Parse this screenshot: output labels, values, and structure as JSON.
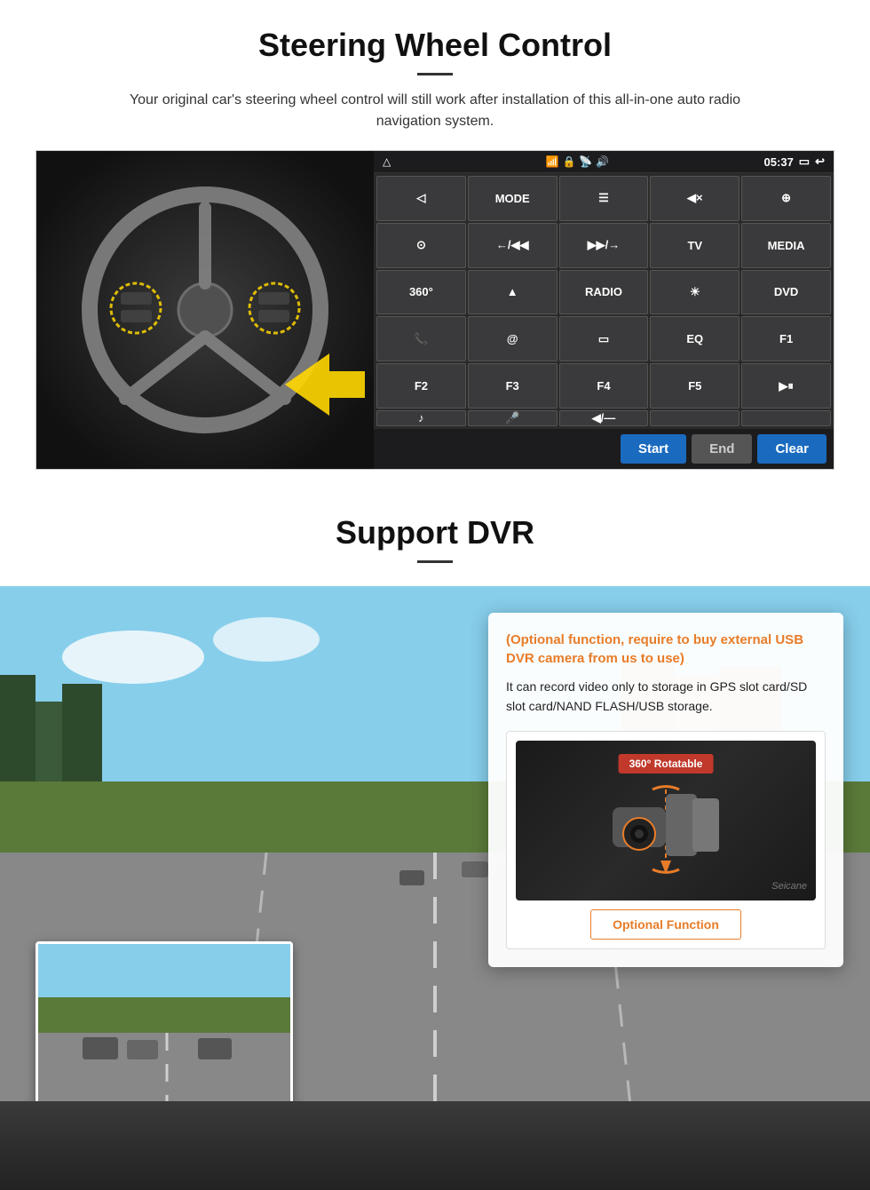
{
  "steering_section": {
    "title": "Steering Wheel Control",
    "description": "Your original car's steering wheel control will still work after installation of this all-in-one auto radio navigation system.",
    "status_bar": {
      "time": "05:37",
      "back_icon": "↩",
      "home_icon": "△",
      "wifi_icon": "wifi",
      "lock_icon": "🔒",
      "signal_icon": "📶",
      "sound_icon": "🔊"
    },
    "grid_buttons": [
      {
        "label": "◁",
        "row": 1,
        "col": 1
      },
      {
        "label": "MODE",
        "row": 1,
        "col": 2
      },
      {
        "label": "☰",
        "row": 1,
        "col": 3
      },
      {
        "label": "◀×",
        "row": 1,
        "col": 4
      },
      {
        "label": "⊕",
        "row": 1,
        "col": 5
      },
      {
        "label": "⊙",
        "row": 2,
        "col": 1
      },
      {
        "label": "←/◀◀",
        "row": 2,
        "col": 2
      },
      {
        "label": "▶▶/→",
        "row": 2,
        "col": 3
      },
      {
        "label": "TV",
        "row": 2,
        "col": 4
      },
      {
        "label": "MEDIA",
        "row": 2,
        "col": 5
      },
      {
        "label": "360°",
        "row": 3,
        "col": 1
      },
      {
        "label": "▲",
        "row": 3,
        "col": 2
      },
      {
        "label": "RADIO",
        "row": 3,
        "col": 3
      },
      {
        "label": "☀",
        "row": 3,
        "col": 4
      },
      {
        "label": "DVD",
        "row": 3,
        "col": 5
      },
      {
        "label": "📞",
        "row": 4,
        "col": 1
      },
      {
        "label": "@",
        "row": 4,
        "col": 2
      },
      {
        "label": "▭",
        "row": 4,
        "col": 3
      },
      {
        "label": "EQ",
        "row": 4,
        "col": 4
      },
      {
        "label": "F1",
        "row": 4,
        "col": 5
      },
      {
        "label": "F2",
        "row": 5,
        "col": 1
      },
      {
        "label": "F3",
        "row": 5,
        "col": 2
      },
      {
        "label": "F4",
        "row": 5,
        "col": 3
      },
      {
        "label": "F5",
        "row": 5,
        "col": 4
      },
      {
        "label": "▶⏸",
        "row": 5,
        "col": 5
      },
      {
        "label": "♪",
        "row": 6,
        "col": 1
      },
      {
        "label": "🎤",
        "row": 6,
        "col": 2
      },
      {
        "label": "◀/—",
        "row": 6,
        "col": 3
      }
    ],
    "action_buttons": {
      "start": "Start",
      "end": "End",
      "clear": "Clear"
    }
  },
  "dvr_section": {
    "title": "Support DVR",
    "optional_title": "(Optional function, require to buy external USB DVR camera from us to use)",
    "description": "It can record video only to storage in GPS slot card/SD slot card/NAND FLASH/USB storage.",
    "rotatable_badge": "360° Rotatable",
    "watermark": "Seicane",
    "optional_function_label": "Optional Function"
  }
}
